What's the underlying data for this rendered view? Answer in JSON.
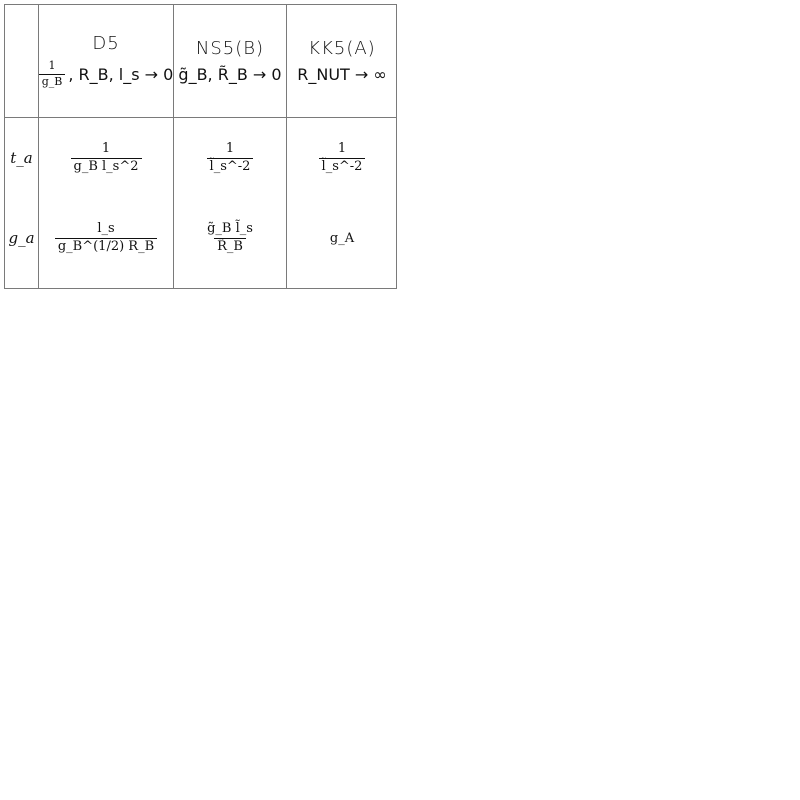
{
  "table": {
    "columns": [
      {
        "name": "D5",
        "limit": {
          "fraction_num": "1",
          "fraction_den": "g_B",
          "rest": ", R_B, l_s → 0"
        }
      },
      {
        "name": "NS5(B)",
        "limit": {
          "text": "g̃_B, R̃_B → 0"
        }
      },
      {
        "name": "KK5(A)",
        "limit": {
          "text": "R_NUT → ∞"
        }
      }
    ],
    "rows": [
      {
        "label": "t_a",
        "cells": [
          {
            "num": "1",
            "den": "g_B l_s^2"
          },
          {
            "num": "1",
            "den": "l̃_s^-2"
          },
          {
            "num": "1",
            "den": "l̃_s^-2"
          }
        ]
      },
      {
        "label": "g_a",
        "cells": [
          {
            "num": "l_s",
            "den": "g_B^(1/2) R_B"
          },
          {
            "num": "g̃_B l̃_s",
            "den": "R̃_B"
          },
          {
            "text": "g_A"
          }
        ]
      }
    ]
  }
}
